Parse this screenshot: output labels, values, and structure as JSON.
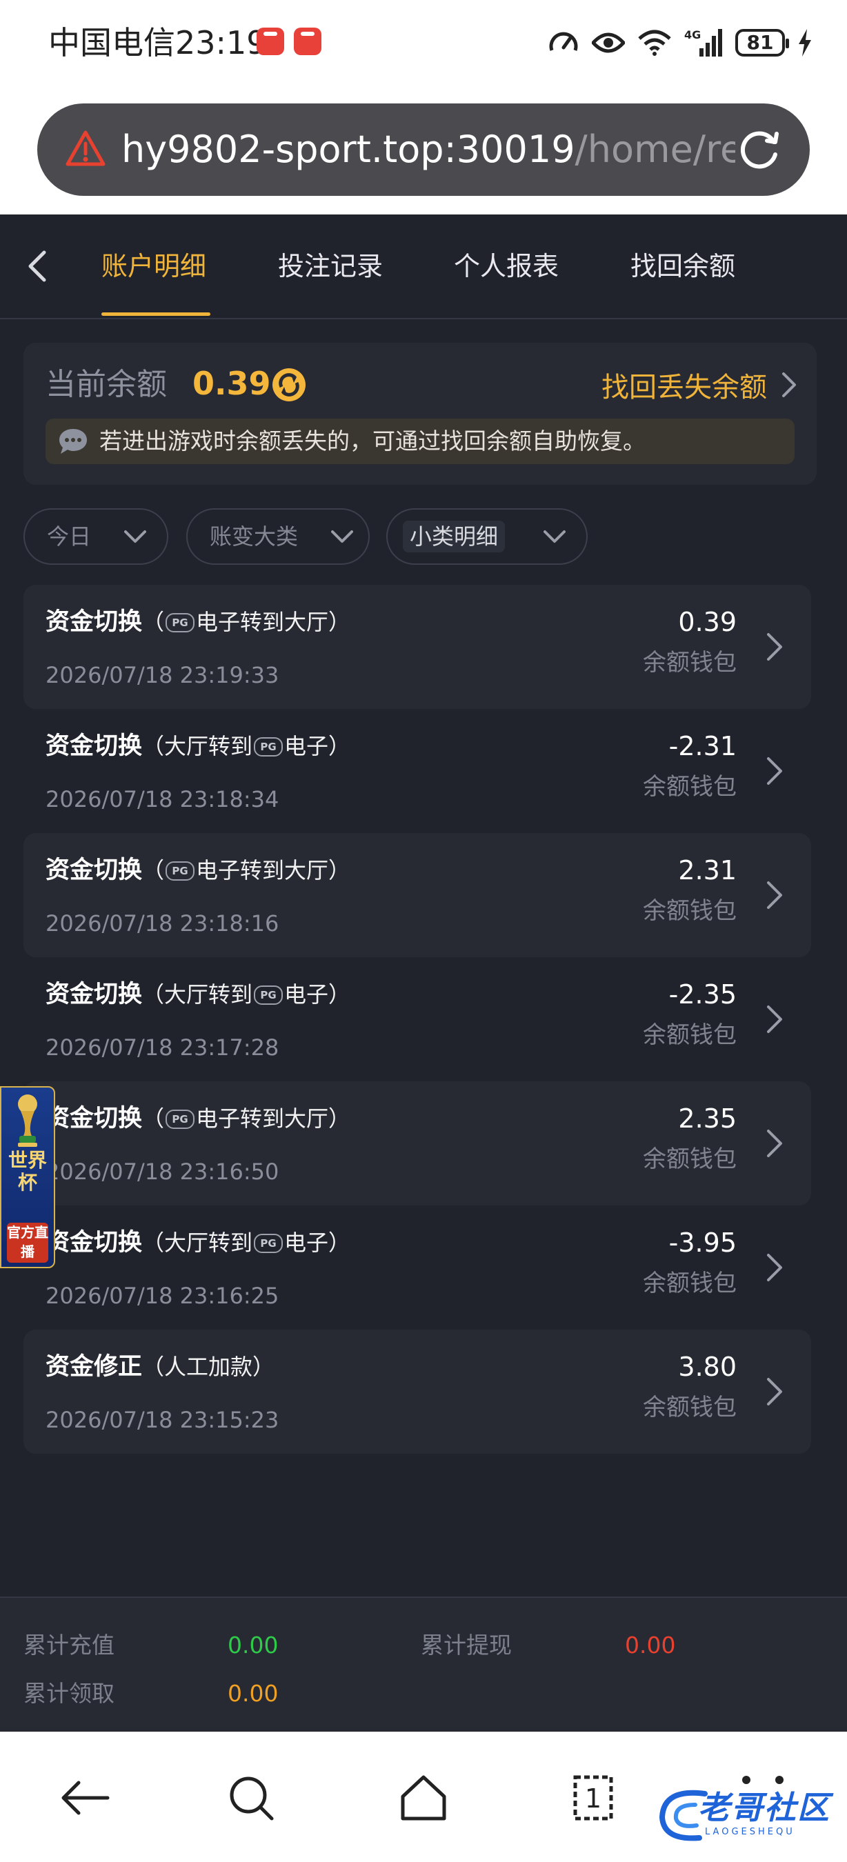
{
  "status_bar": {
    "carrier": "中国电信",
    "time": "23:19",
    "network": "4G",
    "battery": "81"
  },
  "browser": {
    "url_host": "hy9802-sport.top:30019",
    "url_path": "/home/re"
  },
  "tabs": [
    {
      "label": "账户明细"
    },
    {
      "label": "投注记录"
    },
    {
      "label": "个人报表"
    },
    {
      "label": "找回余额"
    }
  ],
  "balance": {
    "label": "当前余额",
    "value": "0.39",
    "recover_link": "找回丢失余额",
    "notice": "若进出游戏时余额丢失的，可通过找回余额自助恢复。"
  },
  "filters": [
    {
      "label": "今日"
    },
    {
      "label": "账变大类"
    },
    {
      "label": "小类明细"
    }
  ],
  "records": [
    {
      "type": "资金切换",
      "pre": "（",
      "mid": "电子转到大厅）",
      "time": "2026/07/18 23:19:33",
      "amount": "0.39",
      "wallet": "余额钱包"
    },
    {
      "type": "资金切换",
      "pre": "（大厅转到",
      "mid": "电子）",
      "time": "2026/07/18 23:18:34",
      "amount": "-2.31",
      "wallet": "余额钱包"
    },
    {
      "type": "资金切换",
      "pre": "（",
      "mid": "电子转到大厅）",
      "time": "2026/07/18 23:18:16",
      "amount": "2.31",
      "wallet": "余额钱包"
    },
    {
      "type": "资金切换",
      "pre": "（大厅转到",
      "mid": "电子）",
      "time": "2026/07/18 23:17:28",
      "amount": "-2.35",
      "wallet": "余额钱包"
    },
    {
      "type": "资金切换",
      "pre": "（",
      "mid": "电子转到大厅）",
      "time": "2026/07/18 23:16:50",
      "amount": "2.35",
      "wallet": "余额钱包"
    },
    {
      "type": "资金切换",
      "pre": "（大厅转到",
      "mid": "电子）",
      "time": "2026/07/18 23:16:25",
      "amount": "-3.95",
      "wallet": "余额钱包"
    },
    {
      "type": "资金修正",
      "pre": "（人工加款）",
      "mid": "",
      "time": "2026/07/18 23:15:23",
      "amount": "3.80",
      "wallet": "余额钱包"
    }
  ],
  "pg_logo": "PG",
  "world_cup": {
    "title": "世界杯",
    "live": "官方直播"
  },
  "summary": {
    "deposit_label": "累计充值",
    "deposit_value": "0.00",
    "withdraw_label": "累计提现",
    "withdraw_value": "0.00",
    "claim_label": "累计领取",
    "claim_value": "0.00"
  },
  "watermark": {
    "text": "老哥社区",
    "sub": "LAOGESHEQU"
  },
  "colors": {
    "accent": "#f0b43a",
    "positive": "#2ecb4a",
    "negative": "#e8412f",
    "claim": "#f0a022",
    "background": "#20232c",
    "card": "#272a33"
  },
  "nav_tab_count": "1"
}
